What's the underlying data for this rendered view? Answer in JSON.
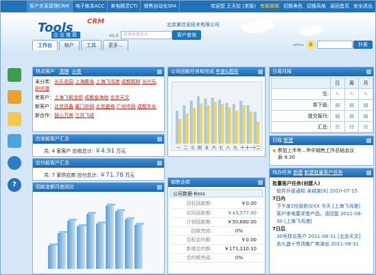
{
  "topbar": {
    "tabs": [
      "客户关系管理CRM",
      "电子帐本ACC",
      "来电精灵CTI",
      "销售自动化SFA"
    ],
    "welcome": "欢迎您 王天虹 (老板)",
    "unread": "有邮邮邮",
    "switch_role": "切换角色",
    "switch_style": "切换风格",
    "back_home": "返回首页",
    "logout": "安全退出"
  },
  "logo": {
    "tools": "Tools",
    "crm": "CRM",
    "sub": "企业推荐",
    "ver": "V5.0"
  },
  "company": "北京某信息技术有限公司",
  "search": {
    "placeholder": "支持拼音手头",
    "button": "客户查询"
  },
  "nav_tabs": [
    "工作台",
    "帐户",
    "工具",
    "更多..."
  ],
  "profile": {
    "label": "offline",
    "count": "0"
  },
  "top_search_button": "扑索",
  "hot": {
    "title": "热点客户",
    "manage": "清理",
    "share": "分类",
    "rows": [
      {
        "label": "未分类：",
        "items": [
          "长乐花园",
          "上海鹿岛",
          "上海飞鸿港",
          "成都鹅材",
          "长兴乐",
          "护闲港"
        ]
      },
      {
        "label": "老客户：",
        "items": [
          "上海飞枫宝绩",
          "成都金海地",
          "北京天文"
        ]
      },
      {
        "label": "新客户：",
        "items": [
          "北京凯鑫",
          "厦门中网",
          "北京盛格",
          "广州中网",
          "成都东长",
          ""
        ]
      },
      {
        "label": "新合作：",
        "items": [
          "鼓山万商",
          "江苏飞成"
        ]
      }
    ]
  },
  "receivable": {
    "title": "应收款客户汇总",
    "pre": "共:",
    "count": "4",
    "mid": "家客户  应收总计:",
    "amount": "￥4.91",
    "unit": "万元"
  },
  "payable": {
    "title": "应付款客户汇总",
    "pre": "共:",
    "count": "7",
    "mid": "家供应商  应付总计:",
    "amount": "￥71.78",
    "unit": "万元"
  },
  "chart_left": {
    "title": "回款金额月度同比"
  },
  "chart_mid": {
    "title": "公司回款任务和完成",
    "tabs": "年度&图形"
  },
  "chart_data": {
    "type": "bar",
    "categories": [
      "一",
      "二",
      "三",
      "四",
      "五",
      "六",
      "七",
      "八",
      "九",
      "十",
      "十一",
      "十二"
    ],
    "series": [
      {
        "values": [
          60,
          70,
          78,
          86,
          82,
          84,
          80,
          74,
          72,
          78,
          70,
          58
        ]
      },
      {
        "values": [
          45,
          55,
          65,
          73,
          70,
          76,
          72,
          66,
          60,
          70,
          58,
          40
        ]
      }
    ],
    "ylim": [
      0,
      100
    ]
  },
  "calendar": {
    "title": "日周月报",
    "headers": [
      "日",
      "周",
      "月"
    ],
    "rows": [
      {
        "label": "写:"
      },
      {
        "label": "章下级:"
      },
      {
        "label": "提交报刊:"
      },
      {
        "label": "汇总:"
      }
    ]
  },
  "schedule": {
    "title": "日程",
    "new": "新建",
    "text": "参加上半年...年中销售工作总结会议",
    "time": "辰 9:30"
  },
  "sales": {
    "title": "销售业绩",
    "sub": "公司数据-Boss",
    "rows": [
      {
        "label": "目标回款额:",
        "value": "￥0.00"
      },
      {
        "label": "实际回款额:",
        "value": "￥43,577.00"
      },
      {
        "label": "计划回款额:",
        "value": "￥50,680.00"
      },
      {
        "label": "回款完成:",
        "value": "0%"
      },
      {
        "label": "目标合约额:",
        "value": "￥0.00"
      },
      {
        "label": "新增合约额:",
        "value": "￥171,210.10"
      },
      {
        "label": "合约额完成:",
        "value": "0%"
      }
    ]
  },
  "tasks": {
    "title": "待办任务",
    "new": "新建",
    "title2": "新建批量客户任务",
    "items": [
      {
        "t": "批量客户任务(创建人)",
        "c": "#222"
      },
      {
        "t": "软件升级通知 未结束[6] 2010-07-15",
        "c": "#1f5ea8"
      },
      {
        "t": "7日内",
        "c": "#222"
      },
      {
        "t": "下午发2份投影仪XX 今天 [上海飞鸿港]",
        "c": "#1f5ea8"
      },
      {
        "t": "客户来电要求查产品，请回复 2011-08-",
        "c": "#1f5ea8"
      },
      {
        "t": "30 [上海飞鸿港]",
        "c": "#1f5ea8"
      },
      {
        "t": "7日后",
        "c": "#222"
      },
      {
        "t": "30号拜访客户 2011-08-31 [北京天文]",
        "c": "#1f5ea8"
      },
      {
        "t": "去九盛十市场推广商演出 2011-08-31",
        "c": "#1f5ea8"
      }
    ]
  }
}
